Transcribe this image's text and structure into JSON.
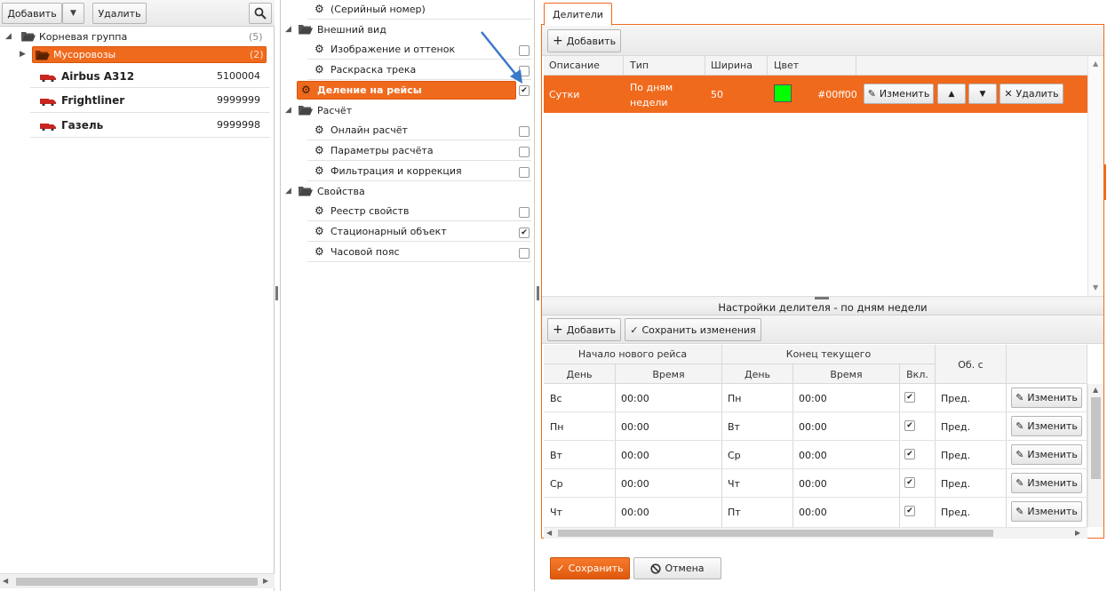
{
  "left_panel": {
    "toolbar": {
      "add_label": "Добавить",
      "dropdown_icon": "caret-down-icon",
      "delete_label": "Удалить",
      "search_icon": "search-icon"
    },
    "tree": {
      "root": {
        "label": "Корневая группа",
        "count": "(5)"
      },
      "group": {
        "label": "Мусоровозы",
        "count": "(2)"
      },
      "vehicles": [
        {
          "name": "Airbus A312",
          "id": "5100004"
        },
        {
          "name": "Frightliner",
          "id": "9999999"
        },
        {
          "name": "Газель",
          "id": "9999998"
        }
      ]
    }
  },
  "middle_panel": {
    "items": [
      {
        "type": "leaf",
        "label": "(Серийный номер)",
        "checked": null
      },
      {
        "type": "group",
        "label": "Внешний вид"
      },
      {
        "type": "leaf",
        "label": "Изображение и оттенок",
        "checked": false
      },
      {
        "type": "leaf",
        "label": "Раскраска трека",
        "checked": false
      },
      {
        "type": "selected",
        "label": "Деление на рейсы",
        "checked": true
      },
      {
        "type": "group",
        "label": "Расчёт"
      },
      {
        "type": "leaf",
        "label": "Онлайн расчёт",
        "checked": false
      },
      {
        "type": "leaf",
        "label": "Параметры расчёта",
        "checked": false
      },
      {
        "type": "leaf",
        "label": "Фильтрация и коррекция",
        "checked": false
      },
      {
        "type": "group",
        "label": "Свойства"
      },
      {
        "type": "leaf",
        "label": "Реестр свойств",
        "checked": false
      },
      {
        "type": "leaf",
        "label": "Стационарный объект",
        "checked": true
      },
      {
        "type": "leaf",
        "label": "Часовой пояс",
        "checked": false
      }
    ]
  },
  "right_panel": {
    "tab_label": "Делители",
    "toolbar": {
      "add_label": "Добавить"
    },
    "dividers_table": {
      "headers": [
        "Описание",
        "Тип",
        "Ширина",
        "Цвет"
      ],
      "row": {
        "description": "Сутки",
        "type_line1": "По дням",
        "type_line2": "недели",
        "width": "50",
        "color_hex": "#00ff00",
        "color_text": "#00ff00",
        "edit_label": "Изменить",
        "up_icon": "arrow-up-icon",
        "down_icon": "arrow-down-icon",
        "delete_label": "Удалить"
      }
    },
    "settings": {
      "title": "Настройки делителя - по дням недели",
      "add_label": "Добавить",
      "save_changes_label": "Сохранить изменения",
      "group_headers": {
        "start": "Начало нового рейса",
        "end": "Конец текущего",
        "ob": "Об. с"
      },
      "sub_headers": {
        "day": "День",
        "time": "Время",
        "day2": "День",
        "time2": "Время",
        "incl": "Вкл."
      },
      "rows": [
        {
          "start_day": "Вс",
          "start_time": "00:00",
          "end_day": "Пн",
          "end_time": "00:00",
          "incl": true,
          "ob": "Пред.",
          "edit_label": "Изменить"
        },
        {
          "start_day": "Пн",
          "start_time": "00:00",
          "end_day": "Вт",
          "end_time": "00:00",
          "incl": true,
          "ob": "Пред.",
          "edit_label": "Изменить"
        },
        {
          "start_day": "Вт",
          "start_time": "00:00",
          "end_day": "Ср",
          "end_time": "00:00",
          "incl": true,
          "ob": "Пред.",
          "edit_label": "Изменить"
        },
        {
          "start_day": "Ср",
          "start_time": "00:00",
          "end_day": "Чт",
          "end_time": "00:00",
          "incl": true,
          "ob": "Пред.",
          "edit_label": "Изменить"
        },
        {
          "start_day": "Чт",
          "start_time": "00:00",
          "end_day": "Пт",
          "end_time": "00:00",
          "incl": true,
          "ob": "Пред.",
          "edit_label": "Изменить"
        }
      ]
    },
    "footer": {
      "save_label": "Сохранить",
      "cancel_label": "Отмена"
    }
  },
  "colors": {
    "accent": "#f06a1d",
    "accent_dark": "#d9560c",
    "border": "#b5b5b5",
    "arrow": "#3a78c8"
  }
}
